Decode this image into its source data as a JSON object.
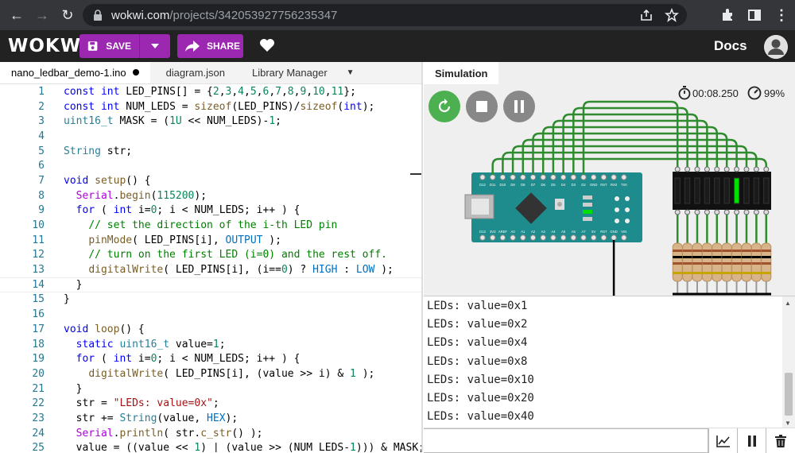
{
  "browser": {
    "url_domain": "wokwi.com",
    "url_path": "/projects/342053927756235347"
  },
  "header": {
    "logo": "WOKWi",
    "save_label": "SAVE",
    "share_label": "SHARE",
    "docs_label": "Docs"
  },
  "editor": {
    "tabs": [
      {
        "label": "nano_ledbar_demo-1.ino",
        "modified": true
      },
      {
        "label": "diagram.json"
      },
      {
        "label": "Library Manager"
      }
    ],
    "line_numbers": [
      "1",
      "2",
      "3",
      "4",
      "5",
      "6",
      "7",
      "8",
      "9",
      "10",
      "11",
      "12",
      "13",
      "14",
      "15",
      "16",
      "17",
      "18",
      "19",
      "20",
      "21",
      "22",
      "23",
      "24",
      "25"
    ],
    "current_line": 14,
    "code_lines": [
      "const int LED_PINS[] = {2,3,4,5,6,7,8,9,10,11};",
      "const int NUM_LEDS = sizeof(LED_PINS)/sizeof(int);",
      "uint16_t MASK = (1U << NUM_LEDS)-1;",
      "",
      "String str;",
      "",
      "void setup() {",
      "  Serial.begin(115200);",
      "  for ( int i=0; i < NUM_LEDS; i++ ) {",
      "    // set the direction of the i-th LED pin",
      "    pinMode( LED_PINS[i], OUTPUT );",
      "    // turn on the first LED (i=0) and the rest off.",
      "    digitalWrite( LED_PINS[i], (i==0) ? HIGH : LOW );",
      "  }",
      "}",
      "",
      "void loop() {",
      "  static uint16_t value=1;",
      "  for ( int i=0; i < NUM_LEDS; i++ ) {",
      "    digitalWrite( LED_PINS[i], (value >> i) & 1 );",
      "  }",
      "  str = \"LEDs: value=0x\";",
      "  str += String(value, HEX);",
      "  Serial.println( str.c_str() );",
      "  value = ((value << 1) | (value >> (NUM_LEDS-1))) & MASK;"
    ]
  },
  "simulation": {
    "tab_label": "Simulation",
    "timer": "00:08.250",
    "speed": "99%",
    "led_states": [
      0,
      0,
      0,
      0,
      0,
      0,
      1,
      0,
      0,
      0
    ],
    "board_pins_top": [
      "D12",
      "D11",
      "D10",
      "D9",
      "D8",
      "D7",
      "D6",
      "D5",
      "D4",
      "D3",
      "D2",
      "GND",
      "RST",
      "RX0",
      "TX0"
    ],
    "board_pins_bottom": [
      "D13",
      "3V3",
      "AREF",
      "A0",
      "A1",
      "A2",
      "A3",
      "A4",
      "A5",
      "A6",
      "A7",
      "5V",
      "RST",
      "GND",
      "VIN"
    ],
    "colors": {
      "start": "#4caf50",
      "stop": "#888888",
      "wire": "#2e8b2e",
      "board": "#1e8c8c",
      "led_on": "#00e000"
    }
  },
  "serial": {
    "lines": [
      "LEDs: value=0x1",
      "LEDs: value=0x2",
      "LEDs: value=0x4",
      "LEDs: value=0x8",
      "LEDs: value=0x10",
      "LEDs: value=0x20",
      "LEDs: value=0x40"
    ]
  }
}
